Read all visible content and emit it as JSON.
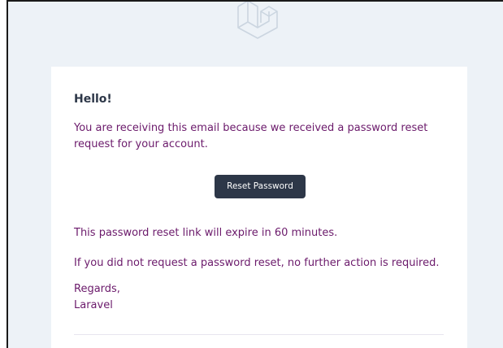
{
  "email": {
    "greeting": "Hello!",
    "intro_line": "You are receiving this email because we received a password reset request for your account.",
    "action_label": "Reset Password",
    "expiry_line": "This password reset link will expire in 60 minutes.",
    "no_action_line": "If you did not request a password reset, no further action is required.",
    "salutation": "Regards,",
    "app_name": "Laravel"
  },
  "logo": {
    "icon": "laravel-logo-icon",
    "color": "#cbd5e0"
  },
  "colors": {
    "background": "#edf2f7",
    "card": "#ffffff",
    "body_text": "#6b1a6b",
    "heading_text": "#2d3748",
    "button": "#2d3748",
    "button_text": "#ffffff"
  }
}
